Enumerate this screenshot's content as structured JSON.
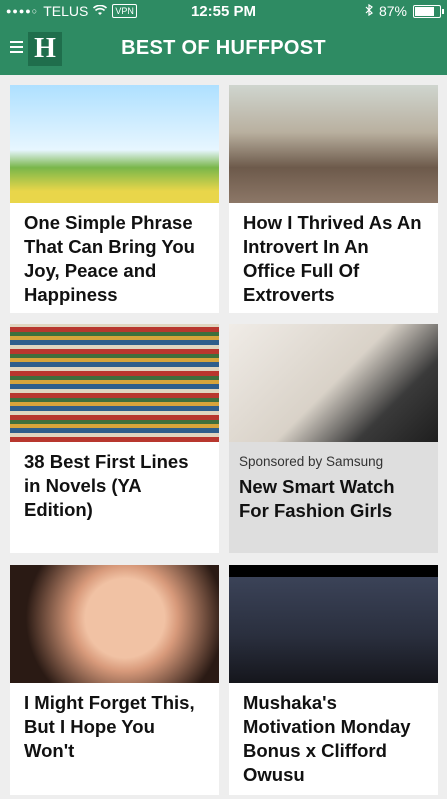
{
  "status_bar": {
    "carrier": "TELUS",
    "vpn": "VPN",
    "time": "12:55 PM",
    "battery": "87%",
    "battery_level": 0.87
  },
  "nav": {
    "logo_letter": "H",
    "title": "BEST OF HUFFPOST"
  },
  "cards": [
    {
      "headline": "One Simple Phrase That Can Bring You Joy, Peace and Happiness"
    },
    {
      "headline": "How I Thrived As An Introvert In An Office Full Of Extroverts"
    },
    {
      "headline": "38 Best First Lines in Novels (YA Edition)"
    },
    {
      "label": "Sponsored by Samsung",
      "headline": "New Smart Watch For Fashion Girls"
    },
    {
      "headline": "I Might Forget This, But I Hope You Won't"
    },
    {
      "headline": "Mushaka's Motivation Monday Bonus x Clifford Owusu"
    }
  ],
  "colors": {
    "brand_green": "#2e8b63",
    "background": "#eeeeee"
  }
}
